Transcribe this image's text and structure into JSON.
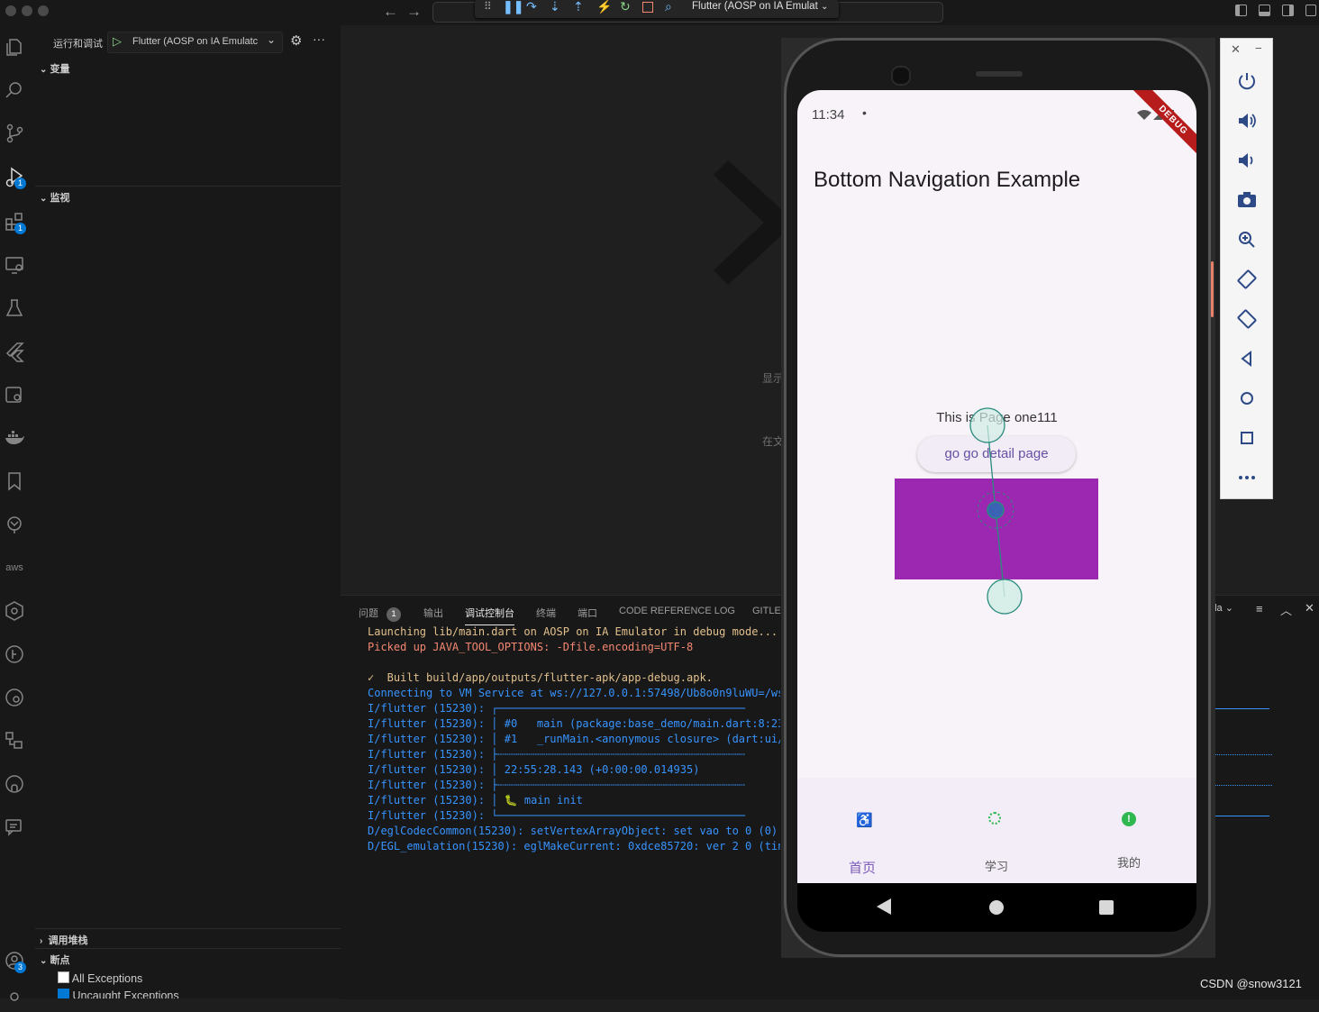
{
  "titlebar": {
    "debug_config": "Flutter (AOSP on IA Emulat"
  },
  "activity_bar": {
    "run_debug_badge": "1",
    "extensions_badge": "1",
    "accounts_badge": "3",
    "aws_label": "aws"
  },
  "sidebar": {
    "header_title": "运行和调试",
    "run_config": "Flutter (AOSP on IA Emulatc",
    "sections": {
      "variables": "变量",
      "watch": "监视",
      "call_stack": "调用堆栈",
      "breakpoints": "断点"
    },
    "breakpoints": [
      {
        "label": "All Exceptions",
        "checked": false
      },
      {
        "label": "Uncaught Exceptions",
        "checked": true
      }
    ]
  },
  "editor": {
    "hint_1": "显示",
    "hint_2": "在文"
  },
  "panel": {
    "tabs": [
      {
        "label": "问题",
        "badge": "1",
        "active": false
      },
      {
        "label": "输出",
        "active": false
      },
      {
        "label": "调试控制台",
        "active": true
      },
      {
        "label": "终端",
        "active": false
      },
      {
        "label": "端口",
        "active": false
      },
      {
        "label": "CODE REFERENCE LOG",
        "active": false
      },
      {
        "label": "GITLE",
        "active": false
      }
    ],
    "filter_dropdown": "ula",
    "log": [
      {
        "text": "Launching lib/main.dart on AOSP on IA Emulator in debug mode...",
        "color": "#e2c08d"
      },
      {
        "text": "Picked up JAVA_TOOL_OPTIONS: -Dfile.encoding=UTF-8",
        "color": "#f48771"
      },
      {
        "text": "",
        "color": "#cccccc"
      },
      {
        "text": "✓  Built build/app/outputs/flutter-apk/app-debug.apk.",
        "color": "#e2c08d"
      },
      {
        "text": "Connecting to VM Service at ws://127.0.0.1:57498/Ub8o0n9luWU=/ws",
        "color": "#3794ff"
      },
      {
        "text": "I/flutter (15230): ┌──────────────────────────────────────",
        "color": "#3794ff"
      },
      {
        "text": "I/flutter (15230): │ #0   main (package:base_demo/main.dart:8:23)",
        "color": "#3794ff"
      },
      {
        "text": "I/flutter (15230): │ #1   _runMain.<anonymous closure> (dart:ui/",
        "color": "#3794ff"
      },
      {
        "text": "I/flutter (15230): ├┄┄┄┄┄┄┄┄┄┄┄┄┄┄┄┄┄┄┄┄┄┄┄┄┄┄┄┄┄┄┄┄┄┄┄┄┄┄",
        "color": "#3794ff"
      },
      {
        "text": "I/flutter (15230): │ 22:55:28.143 (+0:00:00.014935)",
        "color": "#3794ff"
      },
      {
        "text": "I/flutter (15230): ├┄┄┄┄┄┄┄┄┄┄┄┄┄┄┄┄┄┄┄┄┄┄┄┄┄┄┄┄┄┄┄┄┄┄┄┄┄┄",
        "color": "#3794ff"
      },
      {
        "text": "I/flutter (15230): │ 🐛 main init",
        "color": "#3794ff"
      },
      {
        "text": "I/flutter (15230): └──────────────────────────────────────",
        "color": "#3794ff"
      },
      {
        "text": "D/eglCodecCommon(15230): setVertexArrayObject: set vao to 0 (0)",
        "color": "#3794ff"
      },
      {
        "text": "D/EGL_emulation(15230): eglMakeCurrent: 0xdce85720: ver 2 0 (tin",
        "color": "#3794ff"
      }
    ]
  },
  "phone": {
    "time": "11:34",
    "status_dot": "•",
    "debug_banner": "DEBUG",
    "app_title": "Bottom Navigation Example",
    "page_text": "This is Page one111",
    "detail_button": "go go detail page",
    "box_color": "#9c27b0",
    "nav_items": [
      {
        "label": "首页",
        "icon": "accessible-icon",
        "active": true
      },
      {
        "label": "学习",
        "icon": "fingerprint-icon",
        "active": false
      },
      {
        "label": "我的",
        "icon": "alert-circle-icon",
        "active": false
      }
    ],
    "accent": "#7b5cb8",
    "icon_green": "#2fb84f"
  },
  "watermark": "CSDN @snow3121"
}
